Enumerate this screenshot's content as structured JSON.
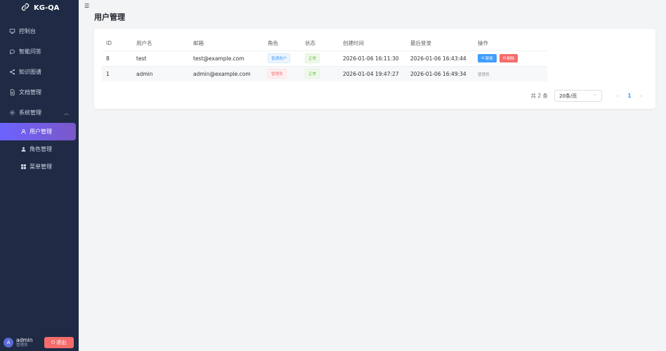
{
  "app": {
    "title": "KG-QA"
  },
  "sidebar": {
    "items": [
      {
        "label": "控制台",
        "icon": "monitor-icon"
      },
      {
        "label": "智能问答",
        "icon": "chat-icon"
      },
      {
        "label": "知识图谱",
        "icon": "share-icon"
      },
      {
        "label": "文档管理",
        "icon": "document-icon"
      },
      {
        "label": "系统管理",
        "icon": "gear-icon"
      }
    ],
    "system_submenu": [
      {
        "label": "用户管理",
        "icon": "user-icon",
        "active": true
      },
      {
        "label": "角色管理",
        "icon": "user-filled-icon"
      },
      {
        "label": "菜单管理",
        "icon": "grid-icon"
      }
    ],
    "user": {
      "avatar_letter": "A",
      "name": "admin",
      "role": "管理员",
      "logout_label": "退出"
    }
  },
  "page": {
    "title": "用户管理"
  },
  "table": {
    "headers": [
      "ID",
      "用户名",
      "邮箱",
      "角色",
      "状态",
      "创建时间",
      "最后登录",
      "操作"
    ],
    "rows": [
      {
        "id": "8",
        "username": "test",
        "email": "test@example.com",
        "role": "普通用户",
        "status": "正常",
        "created": "2026-01-06 16:11:30",
        "last_login": "2026-01-06 16:43:44",
        "disable_label": "禁用",
        "delete_label": "删除"
      },
      {
        "id": "1",
        "username": "admin",
        "email": "admin@example.com",
        "role": "管理员",
        "status": "正常",
        "created": "2026-01-04 19:47:27",
        "last_login": "2026-01-06 16:49:34",
        "op_text": "管理员"
      }
    ]
  },
  "pagination": {
    "total": "共 2 条",
    "page_size": "20条/页",
    "current_page": "1"
  },
  "colors": {
    "sidebar_bg": "#1f2a44",
    "primary": "#409eff",
    "danger": "#f56c6c",
    "success": "#67c23a",
    "active_gradient_start": "#6c63ff"
  }
}
